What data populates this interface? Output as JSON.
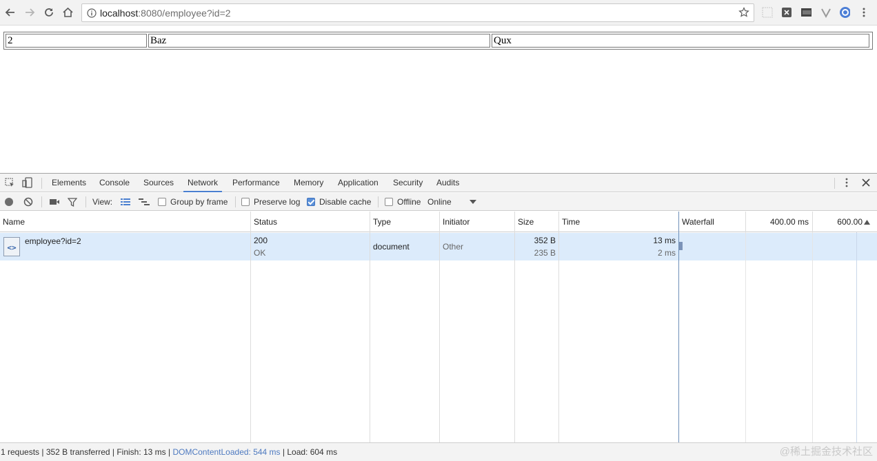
{
  "browser": {
    "url_host": "localhost",
    "url_rest": ":8080/employee?id=2"
  },
  "page": {
    "row": [
      "2",
      "Baz",
      "Qux"
    ]
  },
  "devtools": {
    "tabs": [
      "Elements",
      "Console",
      "Sources",
      "Network",
      "Performance",
      "Memory",
      "Application",
      "Security",
      "Audits"
    ],
    "active_tab": "Network",
    "toolbar": {
      "view_label": "View:",
      "group_by_frame": "Group by frame",
      "preserve_log": "Preserve log",
      "disable_cache": "Disable cache",
      "offline": "Offline",
      "throttle": "Online"
    },
    "columns": [
      "Name",
      "Status",
      "Type",
      "Initiator",
      "Size",
      "Time",
      "Waterfall"
    ],
    "waterfall_ticks": [
      "400.00 ms",
      "600.00"
    ],
    "request": {
      "name": "employee?id=2",
      "status_code": "200",
      "status_text": "OK",
      "type": "document",
      "initiator": "Other",
      "size_transferred": "352 B",
      "size_content": "235 B",
      "time_total": "13 ms",
      "time_latency": "2 ms"
    },
    "status": {
      "summary": "1 requests | 352 B transferred | Finish: 13 ms | ",
      "dcl": "DOMContentLoaded: 544 ms",
      "load": " | Load: 604 ms"
    }
  },
  "watermark": "@稀土掘金技术社区",
  "colors": {
    "selected_row": "#dcebfb",
    "active_tab_underline": "#4a7fd0",
    "dcl_text": "#4e7ac0"
  }
}
